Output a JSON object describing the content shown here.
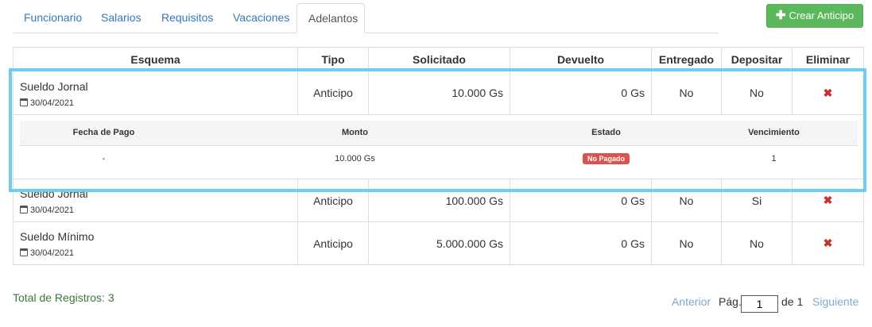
{
  "tabs": [
    {
      "label": "Funcionario"
    },
    {
      "label": "Salarios"
    },
    {
      "label": "Requisitos"
    },
    {
      "label": "Vacaciones"
    },
    {
      "label": "Adelantos",
      "active": true
    }
  ],
  "create_button": {
    "icon": "plus-icon",
    "label": "Crear Anticipo"
  },
  "table": {
    "headers": [
      "Esquema",
      "Tipo",
      "Solicitado",
      "Devuelto",
      "Entregado",
      "Depositar",
      "Eliminar"
    ],
    "rows": [
      {
        "esquema": "Sueldo Jornal",
        "fecha": "30/04/2021",
        "tipo": "Anticipo",
        "solicitado": "10.000 Gs",
        "devuelto": "0 Gs",
        "entregado": "No",
        "depositar": "No",
        "expanded": true
      },
      {
        "esquema": "Sueldo Jornal",
        "fecha": "30/04/2021",
        "tipo": "Anticipo",
        "solicitado": "100.000 Gs",
        "devuelto": "0 Gs",
        "entregado": "No",
        "depositar": "Si"
      },
      {
        "esquema": "Sueldo Mínimo",
        "fecha": "30/04/2021",
        "tipo": "Anticipo",
        "solicitado": "5.000.000 Gs",
        "devuelto": "0 Gs",
        "entregado": "No",
        "depositar": "No"
      }
    ],
    "detail": {
      "headers": [
        "Fecha de Pago",
        "Monto",
        "Estado",
        "Vencimiento"
      ],
      "row": {
        "fecha_pago": "-",
        "monto": "10.000 Gs",
        "estado": "No Pagado",
        "vencimiento": "1"
      }
    }
  },
  "footer": {
    "total": "Total de Registros: 3",
    "prev": "Anterior",
    "page_label": "Pág.",
    "page_value": "1",
    "of_label": "de 1",
    "next": "Siguiente"
  },
  "colors": {
    "accent": "#337ab7",
    "success": "#5cb85c",
    "danger": "#d9534f",
    "highlight": "#6fcdf1"
  }
}
